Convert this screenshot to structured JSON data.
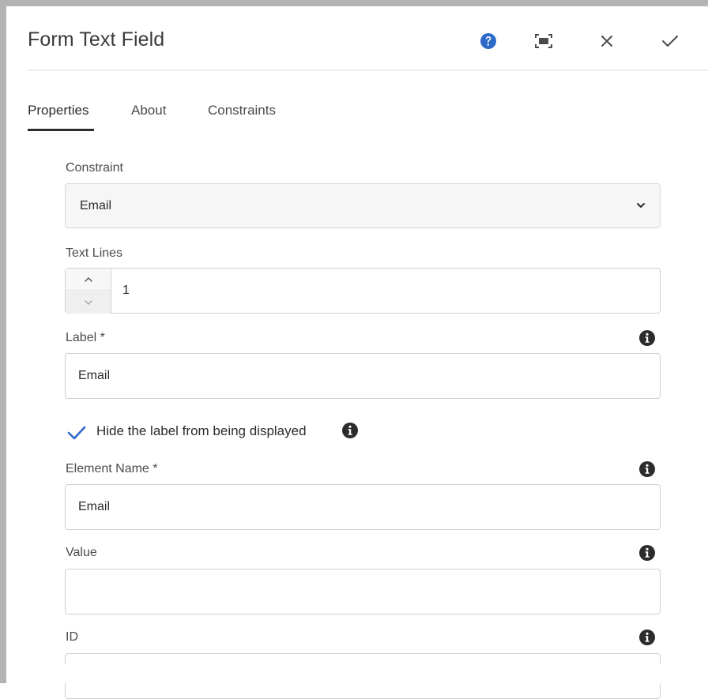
{
  "dialog": {
    "title": "Form Text Field",
    "icons": {
      "help": "help-icon",
      "fullscreen": "fullscreen-icon",
      "close": "close-icon",
      "done": "checkmark-icon"
    },
    "accent": "#2d6bc9"
  },
  "tabs": [
    {
      "label": "Properties",
      "active": true
    },
    {
      "label": "About",
      "active": false
    },
    {
      "label": "Constraints",
      "active": false
    }
  ],
  "form": {
    "constraint": {
      "label": "Constraint",
      "value": "Email"
    },
    "text_lines": {
      "label": "Text Lines",
      "value": "1"
    },
    "label_field": {
      "label": "Label *",
      "value": "Email"
    },
    "hide_label": {
      "label": "Hide the label from being displayed",
      "checked": true
    },
    "element_name": {
      "label": "Element Name *",
      "value": "Email"
    },
    "value_field": {
      "label": "Value",
      "value": ""
    },
    "id_field": {
      "label": "ID",
      "value": ""
    }
  }
}
